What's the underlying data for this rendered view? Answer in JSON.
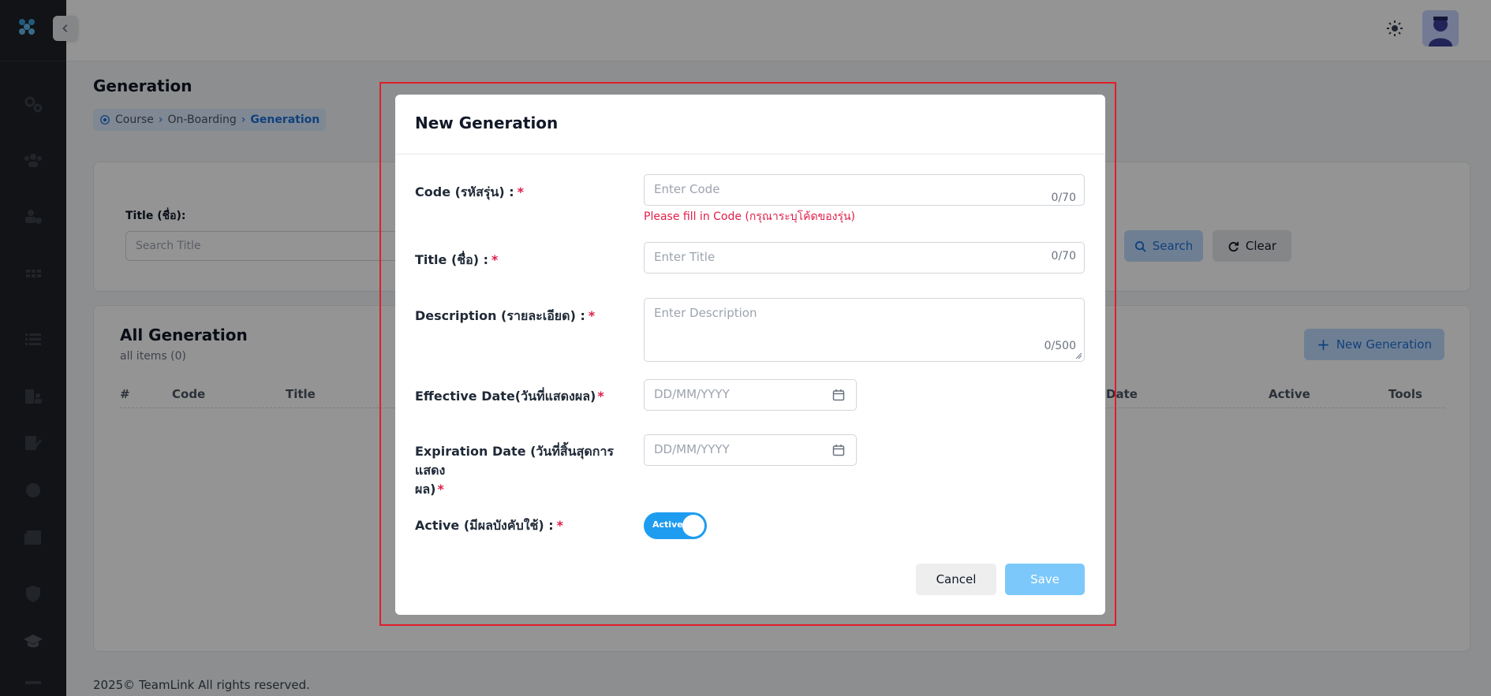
{
  "header": {
    "theme_icon": "sun-icon",
    "avatar_icon": "user-avatar"
  },
  "page": {
    "title": "Generation",
    "breadcrumb": [
      "Course",
      "On-Boarding",
      "Generation"
    ]
  },
  "filter": {
    "label": "Title (ชื่อ):",
    "placeholder": "Search Title",
    "search_label": "Search",
    "clear_label": "Clear"
  },
  "list": {
    "title": "All Generation",
    "subtitle": "all items (0)",
    "new_button": "New Generation",
    "columns": [
      "#",
      "Code",
      "Title",
      "Date",
      "Active",
      "Tools"
    ]
  },
  "footer": {
    "text": "2025© TeamLink All rights reserved."
  },
  "modal": {
    "title": "New Generation",
    "code": {
      "label": "Code (รหัสรุ่น) :",
      "placeholder": "Enter Code",
      "count": "0/70",
      "error": "Please fill in Code (กรุณาระบุโค้ดของรุ่น)"
    },
    "title_field": {
      "label": "Title (ชื่อ) :",
      "placeholder": "Enter Title",
      "count": "0/70"
    },
    "description": {
      "label": "Description (รายละเอียด) :",
      "placeholder": "Enter Description",
      "count": "0/500"
    },
    "effective": {
      "label": "Effective Date(วันที่แสดงผล)",
      "placeholder": "DD/MM/YYYY"
    },
    "expiration": {
      "label_line1": "Expiration Date (วันที่สิ้นสุดการแสดง",
      "label_line2": "ผล)",
      "placeholder": "DD/MM/YYYY"
    },
    "active": {
      "label": "Active (มีผลบังคับใช้) :",
      "toggle_text": "Active",
      "value": true
    },
    "required_mark": "*",
    "cancel_label": "Cancel",
    "save_label": "Save"
  },
  "colors": {
    "primary": "#1e9cf0",
    "error": "#e11d48",
    "highlight": "#e11d2a",
    "sidebar": "#1f2228"
  }
}
